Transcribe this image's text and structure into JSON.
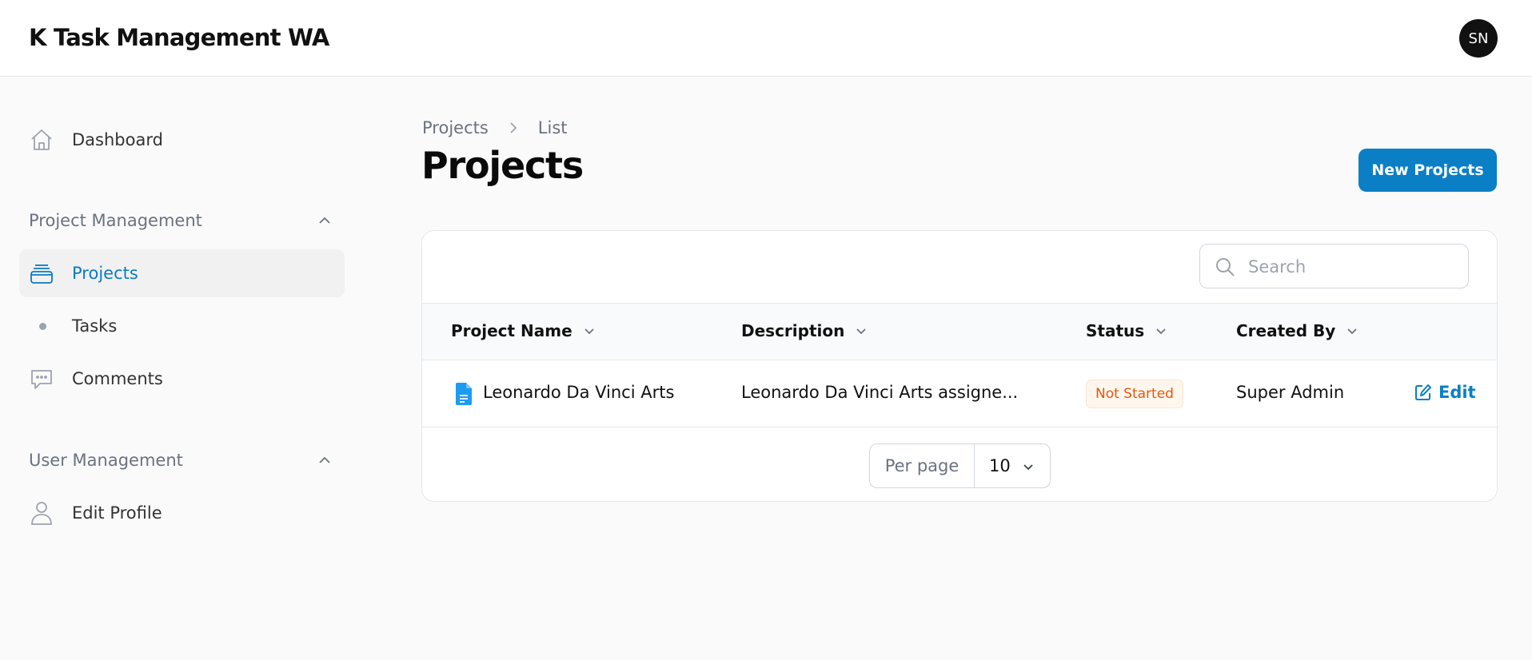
{
  "app": {
    "title": "K Task Management WA",
    "user_initials": "SN"
  },
  "sidebar": {
    "dashboard": {
      "label": "Dashboard",
      "icon": "home-icon"
    },
    "groups": [
      {
        "label": "Project Management",
        "expanded": true,
        "items": [
          {
            "label": "Projects",
            "icon": "folder-stack-icon",
            "active": true
          },
          {
            "label": "Tasks",
            "icon": "dot-icon",
            "active": false
          },
          {
            "label": "Comments",
            "icon": "chat-bubble-icon",
            "active": false
          }
        ]
      },
      {
        "label": "User Management",
        "expanded": true,
        "items": [
          {
            "label": "Edit Profile",
            "icon": "user-icon",
            "active": false
          }
        ]
      }
    ]
  },
  "breadcrumb": [
    "Projects",
    "List"
  ],
  "page": {
    "title": "Projects",
    "new_button": "New Projects"
  },
  "search": {
    "placeholder": "Search",
    "value": ""
  },
  "table": {
    "columns": [
      "Project Name",
      "Description",
      "Status",
      "Created By"
    ],
    "rows": [
      {
        "project_name": "Leonardo Da Vinci Arts",
        "description": "Leonardo Da Vinci Arts assigne...",
        "status": "Not Started",
        "created_by": "Super Admin",
        "action": "Edit"
      }
    ]
  },
  "pagination": {
    "per_page_label": "Per page",
    "per_page_value": "10"
  },
  "colors": {
    "accent": "#0b7fc6",
    "status_not_started_text": "#e4570e",
    "status_not_started_bg": "#fff7ed"
  }
}
